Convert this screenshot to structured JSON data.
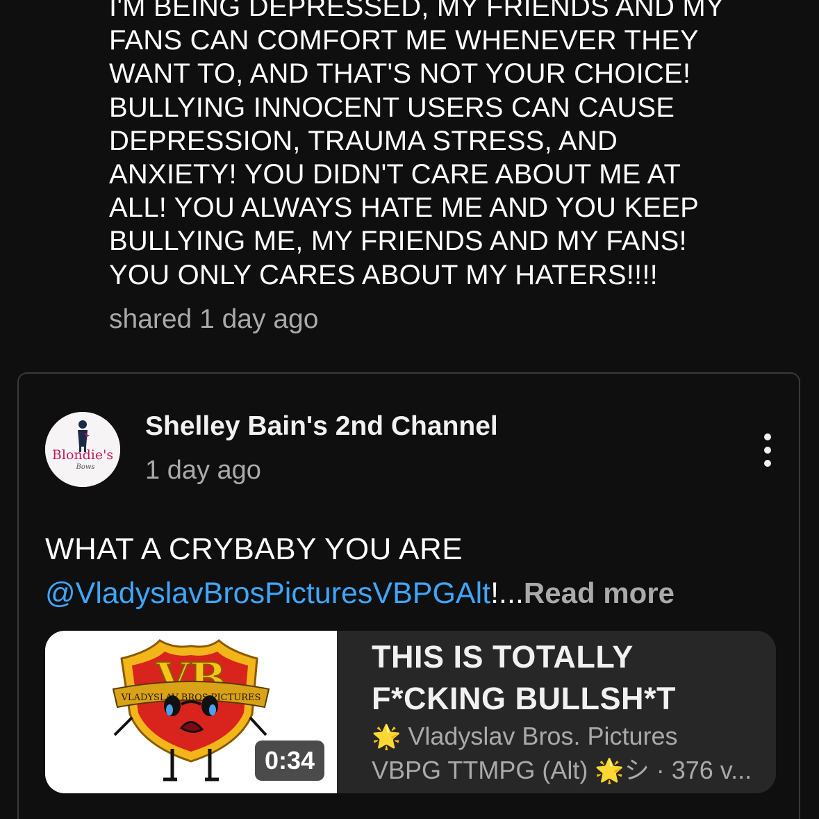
{
  "top_post": {
    "lines": [
      "I'M BEING DEPRESSED, MY FRIENDS AND MY",
      "FANS CAN COMFORT ME WHENEVER THEY",
      "WANT TO, AND THAT'S NOT YOUR CHOICE!",
      "BULLYING INNOCENT USERS CAN CAUSE",
      "DEPRESSION, TRAUMA STRESS, AND",
      "ANXIETY! YOU DIDN'T CARE ABOUT ME AT",
      "ALL! YOU ALWAYS HATE ME AND YOU KEEP",
      "BULLYING ME, MY FRIENDS AND MY FANS!",
      "YOU ONLY CARES ABOUT MY HATERS!!!!"
    ],
    "shared_time": "shared 1 day ago"
  },
  "post": {
    "channel_name": "Shelley Bain's 2nd Channel",
    "time": "1 day ago",
    "avatar_text": "Blondie's",
    "avatar_subtext": "Bows",
    "menu_icon": "more-vert-icon",
    "text": "WHAT A CRYBABY YOU ARE",
    "mention": "@VladyslavBrosPicturesVBPGAlt",
    "ellipsis": "!...",
    "read_more": "Read more"
  },
  "video": {
    "title_line1": "THIS IS TOTALLY",
    "title_line2": "F*CKING BULLSH*T",
    "duration": "0:34",
    "meta_line1": "Vladyslav Bros. Pictures",
    "meta_line2_prefix": "VBPG TTMPG (Alt)",
    "meta_line2_suffix": "シ · 376 v...",
    "star_icon": "🌟",
    "shield_letters": "VB",
    "shield_banner": "VLADYSLAV BROS PICTURES"
  },
  "colors": {
    "background": "#0f0f0f",
    "mention": "#3ea6ff",
    "secondary_text": "#aaaaaa",
    "embed_bg": "#272727"
  }
}
